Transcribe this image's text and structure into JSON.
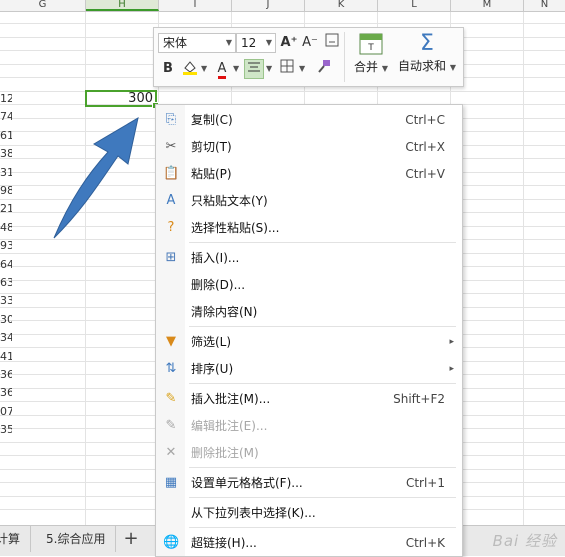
{
  "columns": [
    {
      "letter": "G"
    },
    {
      "letter": "H"
    },
    {
      "letter": "I"
    },
    {
      "letter": "J"
    },
    {
      "letter": "K"
    },
    {
      "letter": "L"
    },
    {
      "letter": "M"
    },
    {
      "letter": "N"
    }
  ],
  "row_values": [
    "12",
    "74",
    "61",
    "38",
    "31",
    "98",
    "21",
    "48",
    "93",
    "64",
    "63",
    "33",
    "30",
    "34",
    "41",
    "36",
    "36",
    "07",
    "35"
  ],
  "selected_cell": {
    "column": "H",
    "value": "300"
  },
  "toolbar": {
    "font_name": "宋体",
    "font_size": "12",
    "grow_font_icon": "A⁺",
    "shrink_font_icon": "A⁻",
    "bold": "B",
    "font_color_letter": "A",
    "merge_label": "合并",
    "autosum_label": "自动求和",
    "autosum_symbol": "Σ"
  },
  "context_menu": {
    "items": [
      {
        "label": "复制(C)",
        "shortcut": "Ctrl+C",
        "icon": "copy-icon",
        "glyph": "⎘"
      },
      {
        "label": "剪切(T)",
        "shortcut": "Ctrl+X",
        "icon": "scissors-icon",
        "glyph": "✂"
      },
      {
        "label": "粘贴(P)",
        "shortcut": "Ctrl+V",
        "icon": "paste-icon",
        "glyph": "📋"
      },
      {
        "label": "只粘贴文本(Y)",
        "shortcut": "",
        "icon": "paste-text-icon",
        "glyph": "A"
      },
      {
        "label": "选择性粘贴(S)...",
        "shortcut": "",
        "icon": "paste-special-icon",
        "glyph": "?"
      },
      {
        "label": "插入(I)...",
        "shortcut": "",
        "icon": "insert-icon",
        "glyph": "⊞"
      },
      {
        "label": "删除(D)...",
        "shortcut": "",
        "icon": "",
        "glyph": ""
      },
      {
        "label": "清除内容(N)",
        "shortcut": "",
        "icon": "",
        "glyph": ""
      },
      {
        "label": "筛选(L)",
        "shortcut": "",
        "icon": "filter-icon",
        "glyph": "▼"
      },
      {
        "label": "排序(U)",
        "shortcut": "",
        "icon": "sort-icon",
        "glyph": "⇅"
      },
      {
        "label": "插入批注(M)...",
        "shortcut": "Shift+F2",
        "icon": "insert-comment-icon",
        "glyph": "✎"
      },
      {
        "label": "编辑批注(E)...",
        "shortcut": "",
        "icon": "edit-comment-icon",
        "glyph": "✎"
      },
      {
        "label": "删除批注(M)",
        "shortcut": "",
        "icon": "delete-comment-icon",
        "glyph": "✕"
      },
      {
        "label": "设置单元格格式(F)...",
        "shortcut": "Ctrl+1",
        "icon": "format-cells-icon",
        "glyph": "▦"
      },
      {
        "label": "从下拉列表中选择(K)...",
        "shortcut": "",
        "icon": "",
        "glyph": ""
      },
      {
        "label": "超链接(H)...",
        "shortcut": "Ctrl+K",
        "icon": "hyperlink-icon",
        "glyph": "🌐"
      }
    ]
  },
  "sheet_tabs": [
    {
      "label": "计算"
    },
    {
      "label": "5.综合应用"
    }
  ],
  "add_sheet_label": "+",
  "watermark": "Bai 经验",
  "colors": {
    "selection_green": "#4aa22c",
    "arrow_blue": "#3f79be"
  }
}
